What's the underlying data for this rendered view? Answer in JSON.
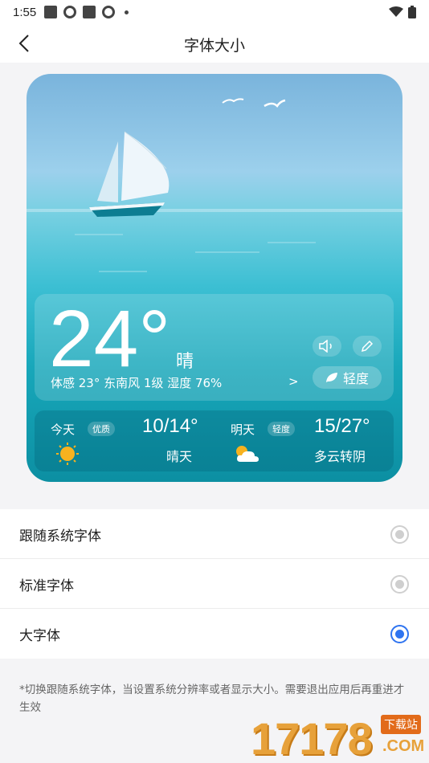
{
  "status_bar": {
    "time": "1:55"
  },
  "header": {
    "title": "字体大小"
  },
  "preview": {
    "temperature": "24°",
    "condition": "晴",
    "details": "体感 23°  东南风 1级  湿度 76%",
    "details_chevron": ">",
    "aqi_label": "轻度",
    "today": {
      "day": "今天",
      "badge": "优质",
      "range": "10/14°",
      "condition": "晴天"
    },
    "tomorrow": {
      "day": "明天",
      "badge": "轻度",
      "range": "15/27°",
      "condition": "多云转阴"
    }
  },
  "options": [
    {
      "label": "跟随系统字体",
      "selected": false
    },
    {
      "label": "标准字体",
      "selected": false
    },
    {
      "label": "大字体",
      "selected": true
    }
  ],
  "note": "*切换跟随系统字体，当设置系统分辨率或者显示大小。需要退出应用后再重进才生效",
  "watermark": {
    "number": "17178",
    "tag": "下载站",
    "domain": ".COM"
  },
  "colors": {
    "accent": "#2f74f0",
    "radio_off": "#cfcfcf",
    "watermark": "#e7a13a"
  }
}
